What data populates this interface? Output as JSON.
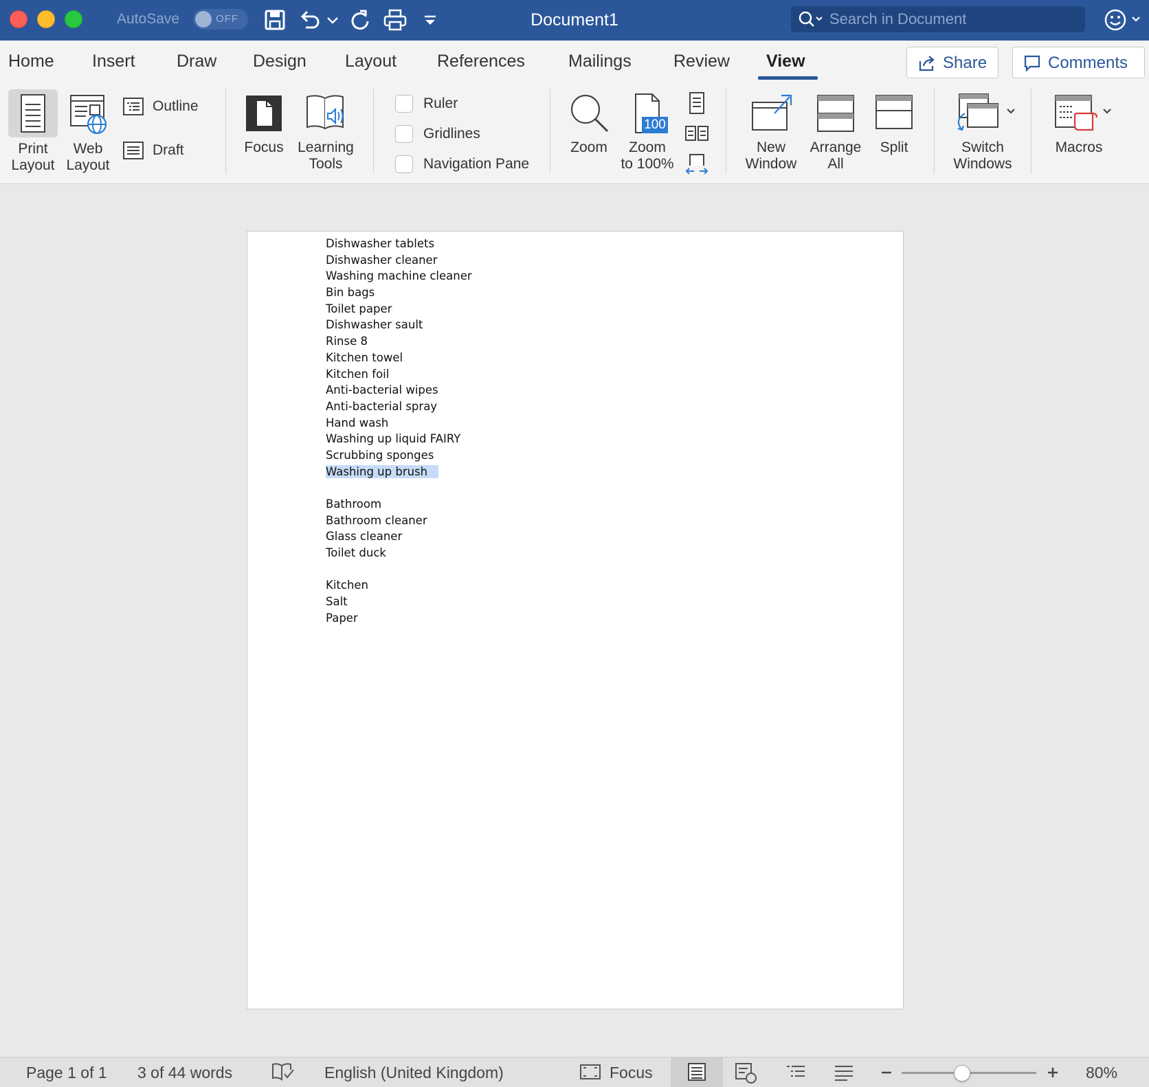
{
  "titlebar": {
    "autosave_label": "AutoSave",
    "autosave_state": "OFF",
    "document_title": "Document1",
    "search_placeholder": "Search in Document"
  },
  "tabs": [
    {
      "label": "Home"
    },
    {
      "label": "Insert"
    },
    {
      "label": "Draw"
    },
    {
      "label": "Design"
    },
    {
      "label": "Layout"
    },
    {
      "label": "References"
    },
    {
      "label": "Mailings"
    },
    {
      "label": "Review"
    },
    {
      "label": "View"
    }
  ],
  "active_tab": "View",
  "actions": {
    "share": "Share",
    "comments": "Comments"
  },
  "ribbon": {
    "print_layout": [
      "Print",
      "Layout"
    ],
    "web_layout": [
      "Web",
      "Layout"
    ],
    "outline": "Outline",
    "draft": "Draft",
    "focus": "Focus",
    "learning_tools": [
      "Learning",
      "Tools"
    ],
    "ruler": "Ruler",
    "gridlines": "Gridlines",
    "navigation_pane": "Navigation Pane",
    "zoom": "Zoom",
    "zoom_100": [
      "Zoom",
      "to 100%"
    ],
    "zoom_100_badge": "100",
    "new_window": [
      "New",
      "Window"
    ],
    "arrange_all": [
      "Arrange",
      "All"
    ],
    "split": "Split",
    "switch_windows": [
      "Switch",
      "Windows"
    ],
    "macros": "Macros"
  },
  "document": {
    "lines": [
      "Dishwasher tablets",
      "Dishwasher cleaner",
      "Washing machine cleaner",
      "Bin bags",
      "Toilet paper",
      "Dishwasher sault",
      "Rinse 8",
      "Kitchen towel",
      "Kitchen foil",
      "Anti-bacterial wipes",
      "Anti-bacterial spray",
      "Hand wash",
      "Washing up liquid FAIRY",
      "Scrubbing sponges",
      "Washing up brush",
      "",
      "Bathroom",
      "Bathroom cleaner",
      "Glass cleaner",
      "Toilet duck",
      "",
      "Kitchen",
      "Salt",
      "Paper"
    ],
    "selected_line": "Washing up brush"
  },
  "status": {
    "page": "Page 1 of 1",
    "words": "3 of 44 words",
    "language": "English (United Kingdom)",
    "focus": "Focus",
    "zoom": "80%",
    "zoom_fraction": 0.45
  },
  "colors": {
    "brand": "#2b579a",
    "selection": "#c6dcf6"
  }
}
